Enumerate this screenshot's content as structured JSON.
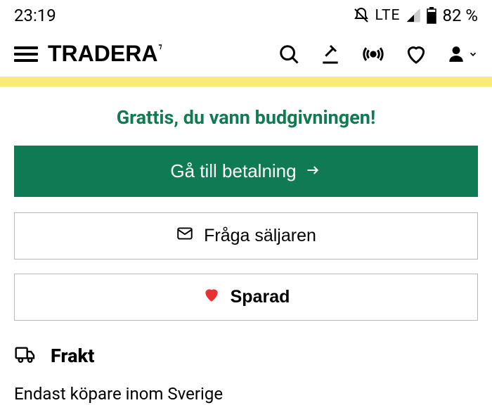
{
  "status": {
    "time": "23:19",
    "network": "LTE",
    "battery": "82 %"
  },
  "header": {
    "brand": "TRADERA"
  },
  "congrats_text": "Grattis, du vann budgivningen!",
  "buttons": {
    "pay": "Gå till betalning",
    "ask": "Fråga säljaren",
    "saved": "Sparad"
  },
  "shipping": {
    "title": "Frakt",
    "subtitle": "Endast köpare inom Sverige"
  }
}
